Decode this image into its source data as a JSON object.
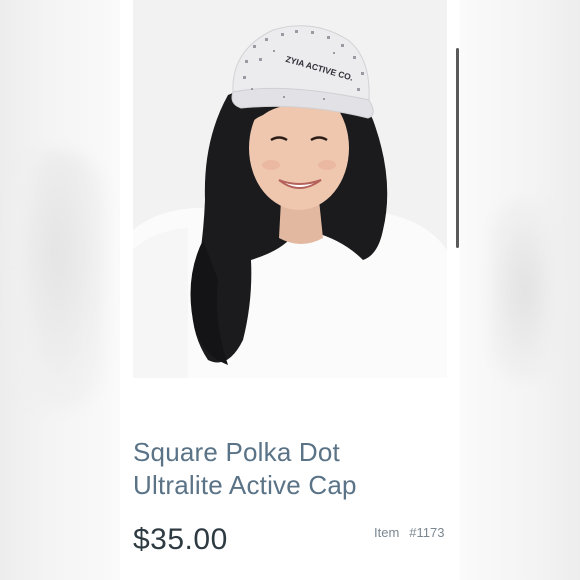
{
  "product": {
    "image_alt": "Woman wearing a white polka dot cap",
    "cap_logo_text": "ZYIA ACTIVE CO.",
    "title_line1": "Square Polka Dot",
    "title_line2": "Ultralite Active Cap",
    "price": "$35.00",
    "item_label": "Item",
    "item_number": "#1173"
  },
  "colors": {
    "title": "#5a7386",
    "price": "#2e3a42",
    "item": "#7b8791",
    "scrollbar": "#5a5a5a"
  }
}
